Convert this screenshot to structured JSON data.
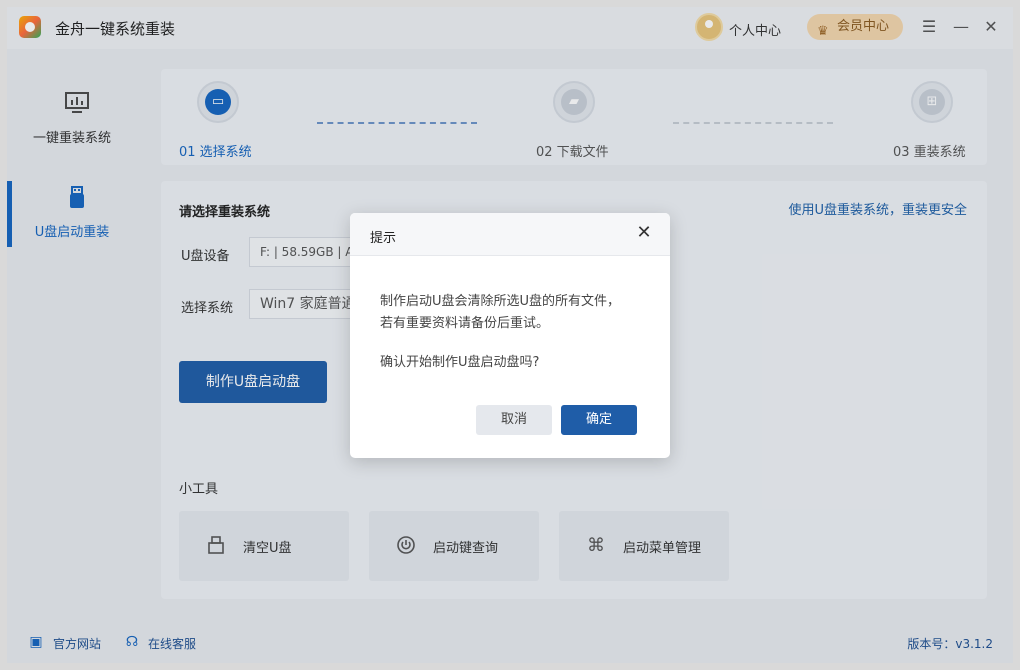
{
  "app": {
    "title": "金舟一键系统重装",
    "user_center": "个人中心",
    "vip_center": "会员中心"
  },
  "sidebar": {
    "items": [
      {
        "label": "一键重装系统",
        "icon": "monitor-icon"
      },
      {
        "label": "U盘启动重装",
        "icon": "usb-icon"
      }
    ]
  },
  "steps": [
    {
      "label": "01 选择系统",
      "active": true
    },
    {
      "label": "02 下载文件",
      "active": false
    },
    {
      "label": "03 重装系统",
      "active": false
    }
  ],
  "main": {
    "title": "请选择重装系统",
    "link": "使用U盘重装系统，重装更安全",
    "device_label": "U盘设备",
    "device_value": "F: | 58.59GB | ASE",
    "system_label": "选择系统",
    "system_value": "Win7 家庭普通",
    "make_button": "制作U盘启动盘",
    "tools_title": "小工具",
    "tools": [
      {
        "label": "清空U盘",
        "icon": "usb-drive-icon"
      },
      {
        "label": "启动键查询",
        "icon": "power-icon"
      },
      {
        "label": "启动菜单管理",
        "icon": "command-icon"
      }
    ]
  },
  "footer": {
    "website": "官方网站",
    "support": "在线客服",
    "version": "版本号：v3.1.2"
  },
  "dialog": {
    "title": "提示",
    "line1": "制作启动U盘会清除所选U盘的所有文件，",
    "line2": "若有重要资料请备份后重试。",
    "question": "确认开始制作U盘启动盘吗?",
    "cancel": "取消",
    "confirm": "确定"
  },
  "colors": {
    "accent": "#1f5da8",
    "active_text": "#1565c0"
  }
}
